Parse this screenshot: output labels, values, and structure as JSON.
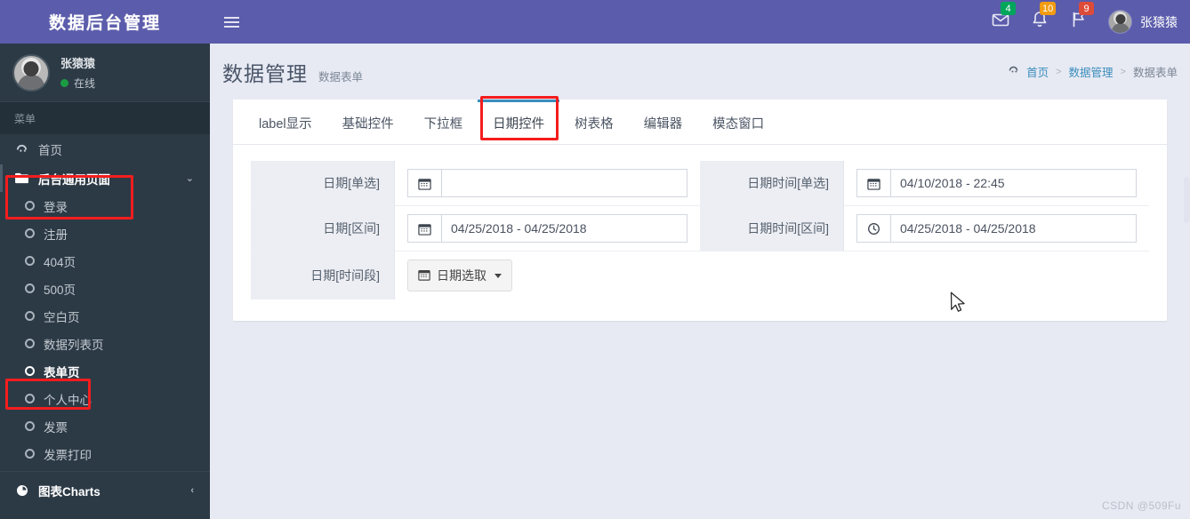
{
  "brand": {
    "title": "数据后台管理"
  },
  "sidebar": {
    "user": {
      "name": "张猿猿",
      "status": "在线"
    },
    "menu_header": "菜单",
    "items": [
      {
        "label": "首页",
        "icon": "dashboard-icon",
        "type": "top"
      },
      {
        "label": "后台通用页面",
        "icon": "folder-icon",
        "type": "expandable",
        "chevron": "⌄",
        "highlighted": true
      },
      {
        "label": "登录",
        "icon": "circle-icon",
        "type": "sub"
      },
      {
        "label": "注册",
        "icon": "circle-icon",
        "type": "sub"
      },
      {
        "label": "404页",
        "icon": "circle-icon",
        "type": "sub"
      },
      {
        "label": "500页",
        "icon": "circle-icon",
        "type": "sub"
      },
      {
        "label": "空白页",
        "icon": "circle-icon",
        "type": "sub"
      },
      {
        "label": "数据列表页",
        "icon": "circle-icon",
        "type": "sub"
      },
      {
        "label": "表单页",
        "icon": "circle-icon",
        "type": "sub",
        "active": true
      },
      {
        "label": "个人中心",
        "icon": "circle-icon",
        "type": "sub"
      },
      {
        "label": "发票",
        "icon": "circle-icon",
        "type": "sub"
      },
      {
        "label": "发票打印",
        "icon": "circle-icon",
        "type": "sub"
      },
      {
        "label": "图表Charts",
        "icon": "pie-chart-icon",
        "type": "charts",
        "chevron": "‹"
      }
    ]
  },
  "topbar": {
    "menu_toggle": "hamburger-icon",
    "notifications": [
      {
        "icon": "envelope-icon",
        "count": "4",
        "color": "#00a65a"
      },
      {
        "icon": "bell-icon",
        "count": "10",
        "color": "#f39c12"
      },
      {
        "icon": "flag-icon",
        "count": "9",
        "color": "#dd4b39"
      }
    ],
    "user_name": "张猿猿"
  },
  "page": {
    "title": "数据管理",
    "subtitle": "数据表单",
    "breadcrumb": [
      {
        "label": "首页",
        "icon": "dashboard-icon"
      },
      {
        "label": "数据管理"
      },
      {
        "label": "数据表单"
      }
    ],
    "breadcrumb_sep": ">"
  },
  "tabs": [
    {
      "label": "label显示",
      "active": false
    },
    {
      "label": "基础控件",
      "active": false
    },
    {
      "label": "下拉框",
      "active": false
    },
    {
      "label": "日期控件",
      "active": true,
      "highlighted": true
    },
    {
      "label": "树表格",
      "active": false
    },
    {
      "label": "编辑器",
      "active": false
    },
    {
      "label": "模态窗口",
      "active": false
    }
  ],
  "form": {
    "rows": [
      {
        "left": {
          "label": "日期[单选]",
          "icon": "calendar-icon",
          "value": "",
          "placeholder": "",
          "control": "input"
        },
        "right": {
          "label": "日期时间[单选]",
          "icon": "calendar-icon",
          "value": "04/10/2018 - 22:45",
          "placeholder": "",
          "control": "input"
        }
      },
      {
        "left": {
          "label": "日期[区间]",
          "icon": "calendar-icon",
          "value": "04/25/2018 - 04/25/2018",
          "placeholder": "",
          "control": "input"
        },
        "right": {
          "label": "日期时间[区间]",
          "icon": "clock-icon",
          "value": "04/25/2018 - 04/25/2018",
          "placeholder": "",
          "control": "input"
        }
      },
      {
        "left": {
          "label": "日期[时间段]",
          "icon": "calendar-icon",
          "value": "日期选取",
          "control": "button"
        },
        "right": null
      }
    ]
  },
  "watermark": "CSDN @509Fu",
  "colors": {
    "header_purple": "#5b5cab",
    "sidebar_dark": "#2c3a46",
    "content_bg": "#e7eaf3",
    "tab_active": "#3c8dbc",
    "annotation_red": "#f41d1d",
    "online_green": "#1b9c43"
  }
}
